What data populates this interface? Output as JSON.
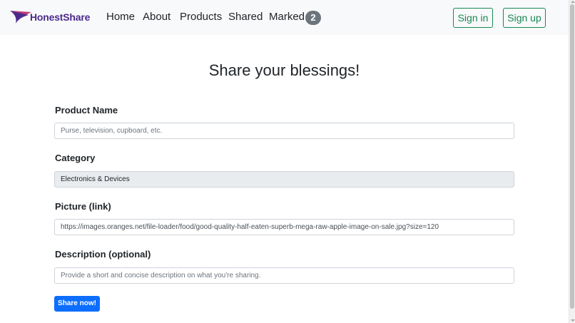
{
  "brand": {
    "name": "HonestShare",
    "logo_icon": "flag-swoosh-icon",
    "colors": {
      "purple": "#4b2a8c",
      "pink": "#c03a7a"
    }
  },
  "nav": {
    "items": [
      {
        "label": "Home"
      },
      {
        "label": "About"
      },
      {
        "label": "Products"
      },
      {
        "label": "Shared"
      },
      {
        "label": "Marked"
      }
    ],
    "marked_count": "2"
  },
  "auth": {
    "signin_label": "Sign in",
    "signup_label": "Sign up",
    "accent": "#198754"
  },
  "page": {
    "title": "Share your blessings!"
  },
  "form": {
    "product_name": {
      "label": "Product Name",
      "placeholder": "Purse, television, cupboard, etc.",
      "value": ""
    },
    "category": {
      "label": "Category",
      "value": "Electronics & Devices"
    },
    "picture": {
      "label": "Picture (link)",
      "value": "https://images.oranges.net/file-loader/food/good-quality-half-eaten-superb-mega-raw-apple-image-on-sale.jpg?size=120"
    },
    "description": {
      "label": "Description (optional)",
      "placeholder": "Provide a short and concise description on what you're sharing.",
      "value": ""
    },
    "submit_label": "Share now!",
    "submit_color": "#0d6efd"
  }
}
